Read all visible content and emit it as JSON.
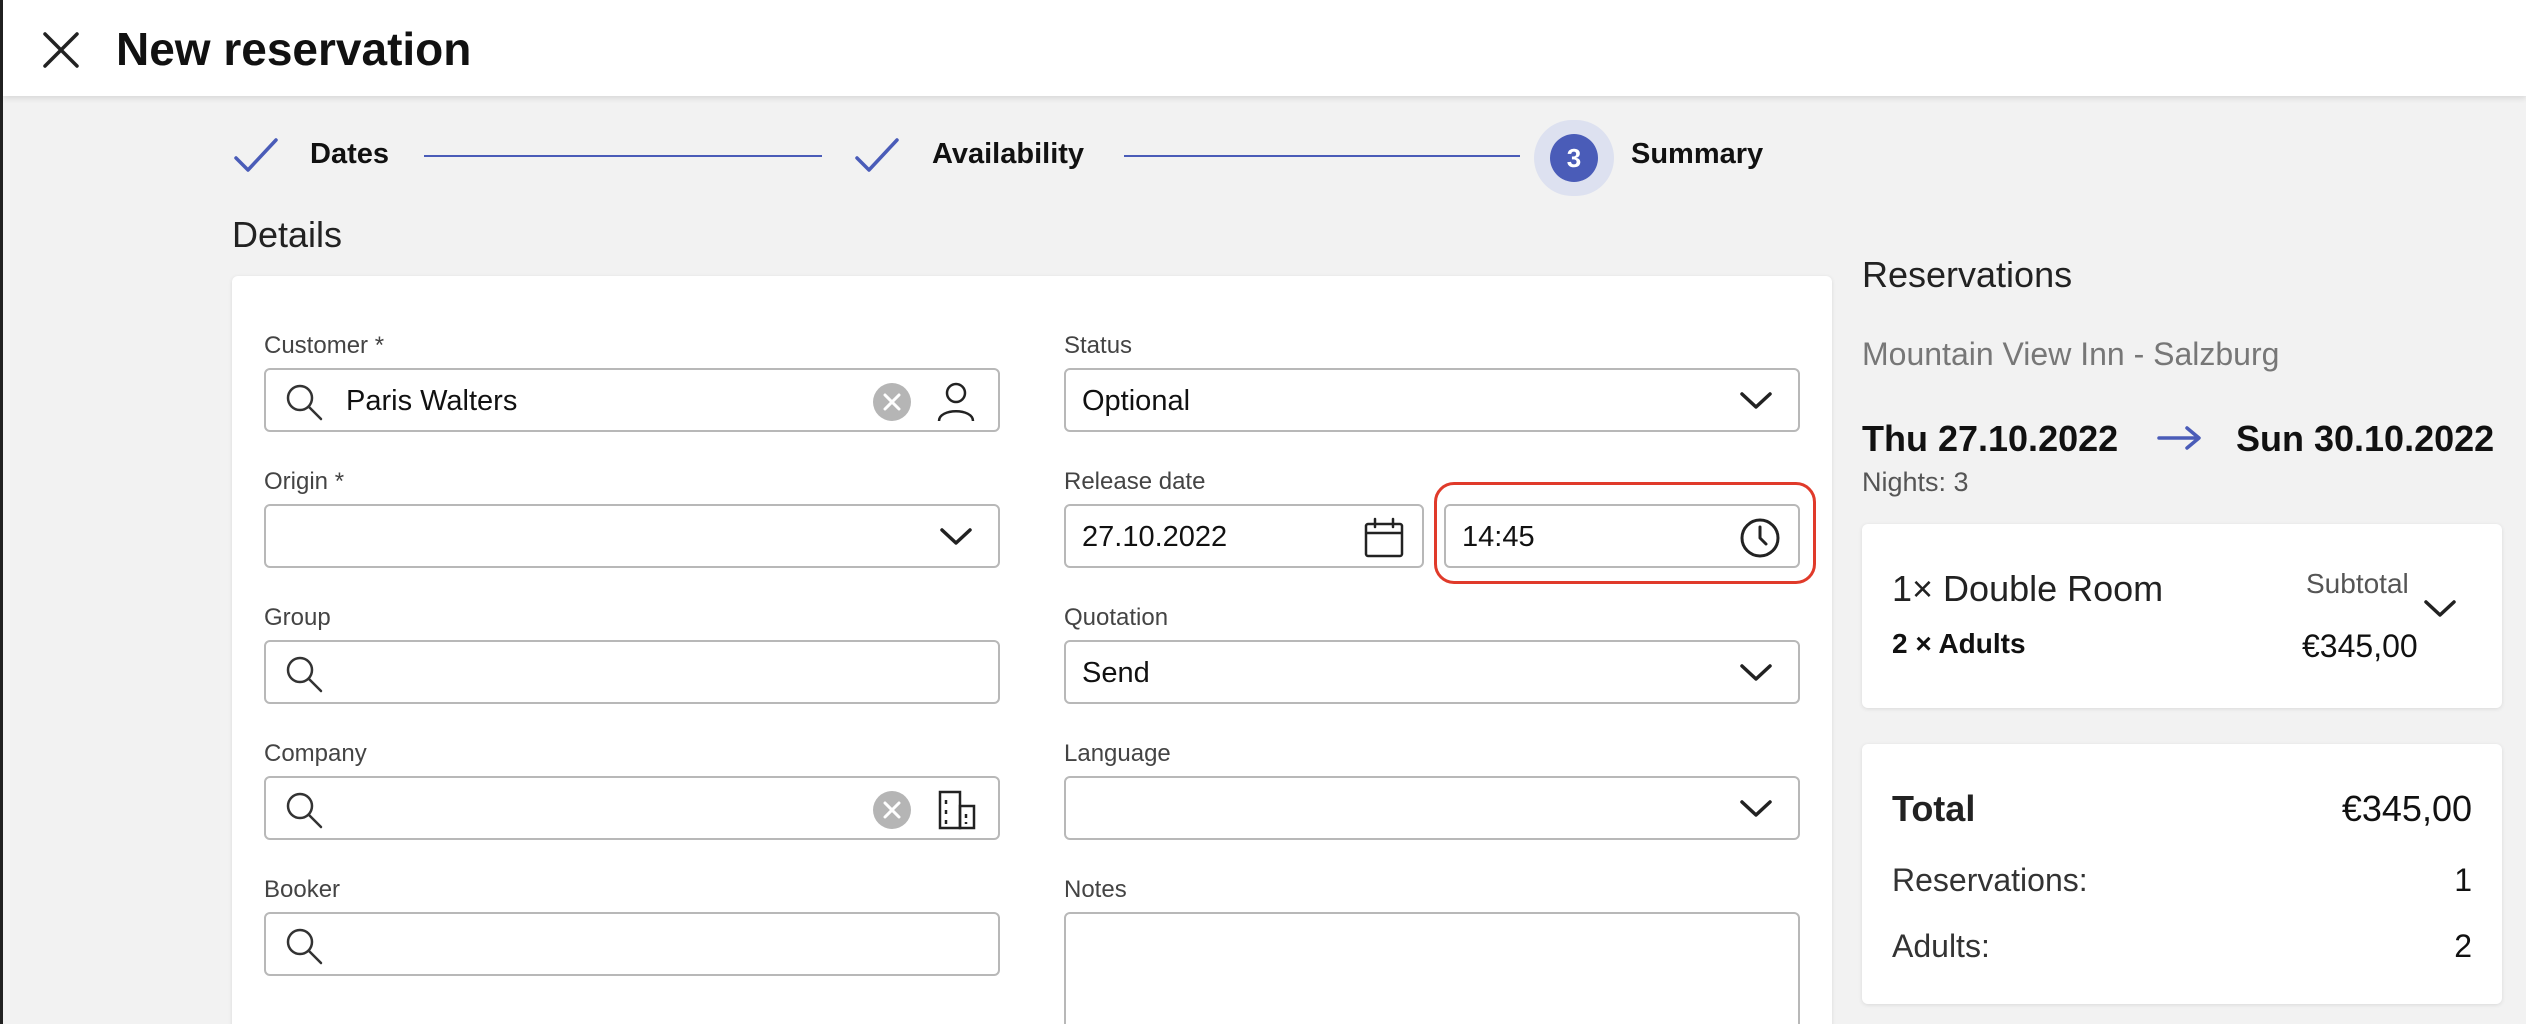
{
  "header": {
    "title": "New reservation"
  },
  "stepper": {
    "steps": [
      {
        "label": "Dates",
        "state": "done"
      },
      {
        "label": "Availability",
        "state": "done"
      },
      {
        "label": "Summary",
        "state": "current",
        "number": "3"
      }
    ]
  },
  "details": {
    "title": "Details",
    "customer": {
      "label": "Customer *",
      "value": "Paris Walters"
    },
    "status": {
      "label": "Status",
      "value": "Optional"
    },
    "origin": {
      "label": "Origin *",
      "value": ""
    },
    "release_date": {
      "label": "Release date",
      "date": "27.10.2022",
      "time": "14:45"
    },
    "group": {
      "label": "Group",
      "value": ""
    },
    "quotation": {
      "label": "Quotation",
      "value": "Send"
    },
    "company": {
      "label": "Company",
      "value": ""
    },
    "language": {
      "label": "Language",
      "value": ""
    },
    "booker": {
      "label": "Booker",
      "value": ""
    },
    "notes": {
      "label": "Notes",
      "value": ""
    }
  },
  "reservations": {
    "title": "Reservations",
    "hotel": "Mountain View Inn - Salzburg",
    "from": "Thu 27.10.2022",
    "to": "Sun 30.10.2022",
    "nights": "Nights: 3",
    "room": {
      "name": "1× Double Room",
      "subtotal_label": "Subtotal",
      "guests": "2 × Adults",
      "price": "€345,00"
    },
    "totals": {
      "total_label": "Total",
      "total_value": "€345,00",
      "reservations_label": "Reservations:",
      "reservations_value": "1",
      "adults_label": "Adults:",
      "adults_value": "2"
    }
  },
  "colors": {
    "accent": "#4a5cb8",
    "highlight": "#e03a2a"
  }
}
